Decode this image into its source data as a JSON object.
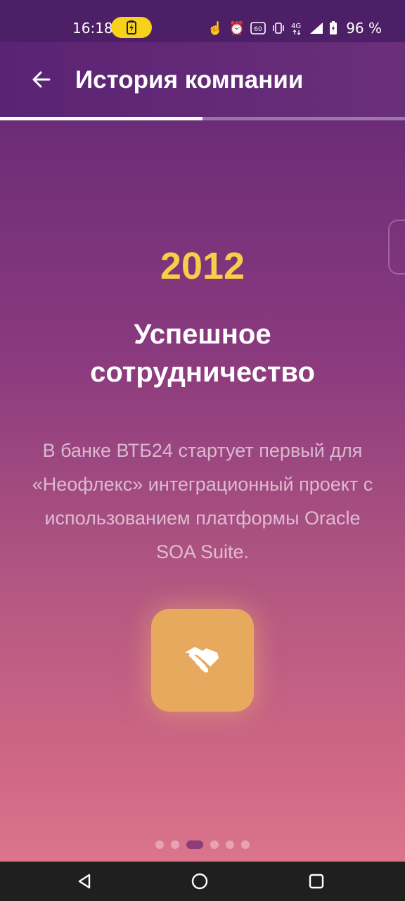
{
  "status_bar": {
    "time": "16:18",
    "battery_percent": "96 %",
    "icons": [
      "battery-charging-icon",
      "touch-icon",
      "alarm-icon",
      "hd-60-icon",
      "vibrate-icon",
      "network-4g-icon",
      "signal-icon",
      "battery-icon"
    ]
  },
  "appbar": {
    "title": "История компании",
    "back_icon": "arrow-left-icon",
    "progress": 0.5
  },
  "slide": {
    "year": "2012",
    "heading": "Успешное сотрудничество",
    "description": "В банке ВТБ24 стартует первый для «Неофлекс» интеграционный проект с использованием платформы Oracle SOA Suite.",
    "icon": "handshake-icon"
  },
  "pager": {
    "count": 6,
    "active_index": 2
  },
  "nav_bar": {
    "buttons": [
      "back-triangle-icon",
      "home-circle-icon",
      "recents-square-icon"
    ]
  },
  "colors": {
    "accent_yellow": "#f7ce4a",
    "icon_card": "#e7a95e",
    "appbar": "#5a2373"
  }
}
